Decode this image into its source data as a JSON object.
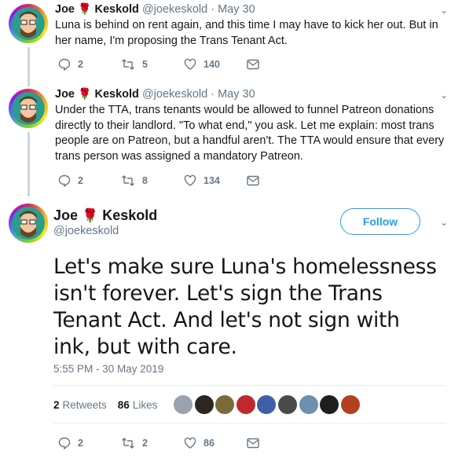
{
  "tweets": [
    {
      "name": "Joe",
      "name2": "Keskold",
      "handle": "@joekeskold",
      "date": "May 30",
      "text": "Luna is behind on rent again, and this time I may have to kick her out. But in her name, I'm proposing the Trans Tenant Act.",
      "replies": "2",
      "retweets": "5",
      "likes": "140"
    },
    {
      "name": "Joe",
      "name2": "Keskold",
      "handle": "@joekeskold",
      "date": "May 30",
      "text": "Under the TTA, trans tenants would be allowed to funnel Patreon donations directly to their landlord. \"To what end,\" you ask. Let me explain: most trans people are on Patreon, but a handful aren't. The TTA would ensure that every trans person was assigned a mandatory Patreon.",
      "replies": "2",
      "retweets": "8",
      "likes": "134"
    }
  ],
  "main": {
    "name": "Joe",
    "name2": "Keskold",
    "handle": "@joekeskold",
    "follow_label": "Follow",
    "text": "Let's make sure Luna's homelessness isn't forever. Let's sign the Trans Tenant Act. And let's not sign with ink, but with care.",
    "timestamp": "5:55 PM - 30 May 2019",
    "retweet_count": "2",
    "retweet_label": "Retweets",
    "like_count": "86",
    "like_label": "Likes",
    "replies": "2",
    "retweets": "2",
    "likes": "86"
  },
  "colors": {
    "accent": "#1da1f2",
    "muted": "#657786",
    "rose": "#e0245e"
  }
}
